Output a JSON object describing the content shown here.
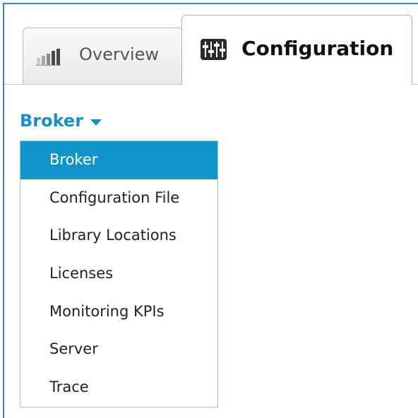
{
  "tabs": {
    "overview": {
      "label": "Overview",
      "icon": "bar-chart-icon"
    },
    "configuration": {
      "label": "Configuration",
      "icon": "sliders-icon",
      "active": true
    }
  },
  "dropdown": {
    "selected_label": "Broker",
    "accent_color": "#1a8fc7"
  },
  "menu": {
    "items": [
      {
        "label": "Broker",
        "selected": true
      },
      {
        "label": "Configuration File"
      },
      {
        "label": "Library Locations"
      },
      {
        "label": "Licenses"
      },
      {
        "label": "Monitoring KPIs"
      },
      {
        "label": "Server"
      },
      {
        "label": "Trace"
      }
    ],
    "selected_color": "#1094c9"
  }
}
